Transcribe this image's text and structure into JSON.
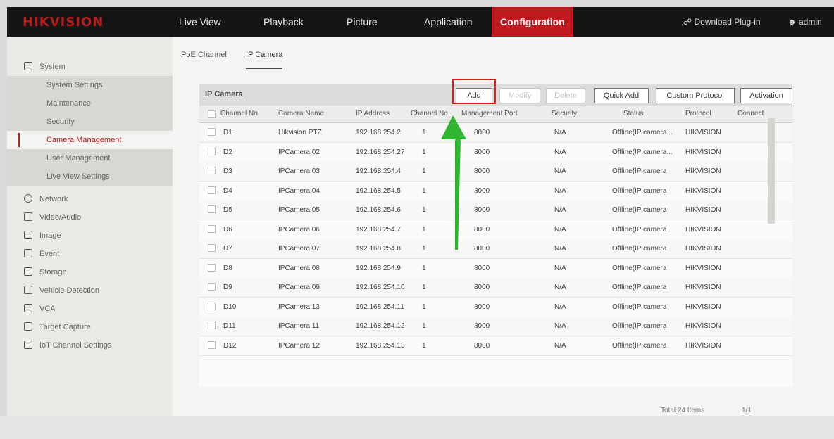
{
  "header": {
    "logo": "HIKVISION",
    "nav": [
      "Live View",
      "Playback",
      "Picture",
      "Application",
      "Configuration"
    ],
    "active_nav": "Configuration",
    "download_plugin": "Download Plug-in",
    "user": "admin"
  },
  "sidebar": {
    "items": [
      {
        "label": "System",
        "icon": "monitor-icon"
      },
      {
        "label": "System Settings"
      },
      {
        "label": "Maintenance"
      },
      {
        "label": "Security"
      },
      {
        "label": "Camera Management"
      },
      {
        "label": "User Management"
      },
      {
        "label": "Live View Settings"
      },
      {
        "label": "Network",
        "icon": "globe-icon"
      },
      {
        "label": "Video/Audio",
        "icon": "video-icon"
      },
      {
        "label": "Image",
        "icon": "image-icon"
      },
      {
        "label": "Event",
        "icon": "event-icon"
      },
      {
        "label": "Storage",
        "icon": "storage-icon"
      },
      {
        "label": "Vehicle Detection",
        "icon": "vehicle-icon"
      },
      {
        "label": "VCA",
        "icon": "vca-icon"
      },
      {
        "label": "Target Capture",
        "icon": "target-icon"
      },
      {
        "label": "IoT Channel Settings",
        "icon": "iot-icon"
      }
    ]
  },
  "tabs": [
    "PoE Channel",
    "IP Camera"
  ],
  "panel": {
    "title": "IP Camera",
    "buttons": [
      "Add",
      "Modify",
      "Delete",
      "Quick Add",
      "Custom Protocol",
      "Activation"
    ],
    "columns": [
      "Channel No.",
      "Camera Name",
      "IP Address",
      "Channel No.",
      "Management Port",
      "Security",
      "Status",
      "Protocol",
      "Connect"
    ],
    "rows": [
      [
        "D1",
        "Hikvision PTZ",
        "192.168.254.2",
        "1",
        "8000",
        "N/A",
        "Offline(IP camera...",
        "HIKVISION"
      ],
      [
        "D2",
        "IPCamera 02",
        "192.168.254.27",
        "1",
        "8000",
        "N/A",
        "Offline(IP camera...",
        "HIKVISION"
      ],
      [
        "D3",
        "IPCamera 03",
        "192.168.254.4",
        "1",
        "8000",
        "N/A",
        "Offline(IP camera",
        "HIKVISION"
      ],
      [
        "D4",
        "IPCamera 04",
        "192.168.254.5",
        "1",
        "8000",
        "N/A",
        "Offline(IP camera",
        "HIKVISION"
      ],
      [
        "D5",
        "IPCamera 05",
        "192.168.254.6",
        "1",
        "8000",
        "N/A",
        "Offline(IP camera",
        "HIKVISION"
      ],
      [
        "D6",
        "IPCamera 06",
        "192.168.254.7",
        "1",
        "8000",
        "N/A",
        "Offline(IP camera",
        "HIKVISION"
      ],
      [
        "D7",
        "IPCamera 07",
        "192.168.254.8",
        "1",
        "8000",
        "N/A",
        "Offline(IP camera",
        "HIKVISION"
      ],
      [
        "D8",
        "IPCamera 08",
        "192.168.254.9",
        "1",
        "8000",
        "N/A",
        "Offline(IP camera",
        "HIKVISION"
      ],
      [
        "D9",
        "IPCamera 09",
        "192.168.254.10",
        "1",
        "8000",
        "N/A",
        "Offline(IP camera",
        "HIKVISION"
      ],
      [
        "D10",
        "IPCamera 13",
        "192.168.254.11",
        "1",
        "8000",
        "N/A",
        "Offline(IP camera",
        "HIKVISION"
      ],
      [
        "D11",
        "IPCamera 11",
        "192.168.254.12",
        "1",
        "8000",
        "N/A",
        "Offline(IP camera",
        "HIKVISION"
      ],
      [
        "D12",
        "IPCamera 12",
        "192.168.254.13",
        "1",
        "8000",
        "N/A",
        "Offline(IP camera",
        "HIKVISION"
      ]
    ],
    "total": "Total 24 Items",
    "pages": "1/1"
  },
  "colors": {
    "accent": "#c0191f",
    "highlight": "#d92020",
    "arrow": "#2fb52f"
  }
}
